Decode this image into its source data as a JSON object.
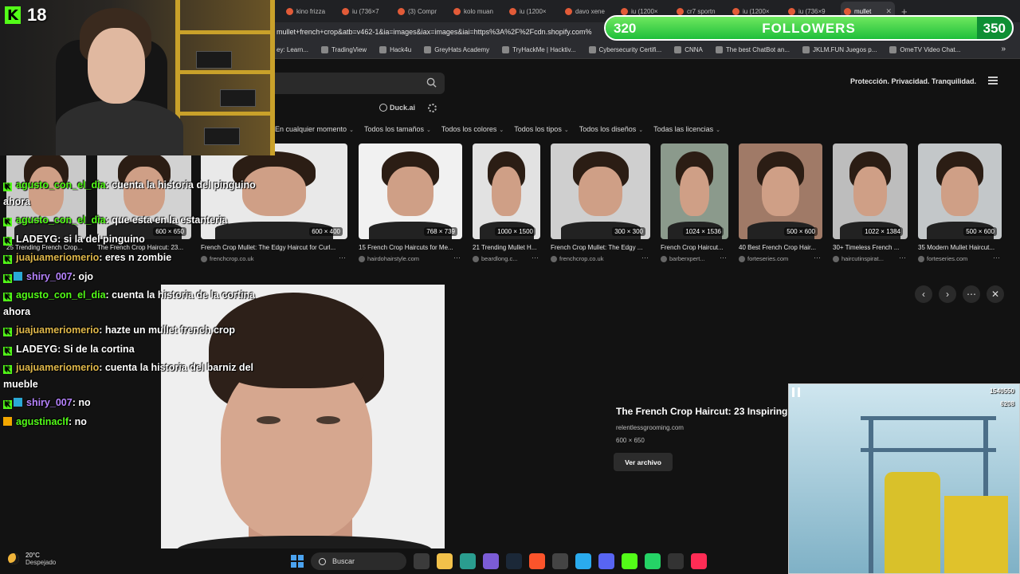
{
  "browser": {
    "tabs": [
      {
        "label": "kino frizza"
      },
      {
        "label": "iu (736×7"
      },
      {
        "label": "(3) Compr"
      },
      {
        "label": "kolo muan"
      },
      {
        "label": "iu (1200×"
      },
      {
        "label": "davo xene"
      },
      {
        "label": "iu (1200×"
      },
      {
        "label": "cr7 sportn"
      },
      {
        "label": "iu (1200×"
      },
      {
        "label": "iu (736×9"
      },
      {
        "label": "mullet"
      }
    ],
    "new_tab": "+",
    "url": "mullet+french+crop&atb=v462-1&ia=images&iax=images&iai=https%3A%2F%2Fcdn.shopify.com%",
    "bookmarks": [
      {
        "label": "ey: Learn..."
      },
      {
        "label": "TradingView"
      },
      {
        "label": "Hack4u"
      },
      {
        "label": "GreyHats Academy"
      },
      {
        "label": "TryHackMe | Hacktiv..."
      },
      {
        "label": "Cybersecurity Certifi..."
      },
      {
        "label": "CNNA"
      },
      {
        "label": "The best ChatBot an..."
      },
      {
        "label": "JKLM.FUN Juegos p..."
      },
      {
        "label": "OmeTV Video Chat..."
      }
    ],
    "bookmarks_more": "»"
  },
  "ddg": {
    "privacy": "Protección. Privacidad. Tranquilidad.",
    "duckai": "Duck.ai",
    "filters": [
      "En cualquier momento",
      "Todos los tamaños",
      "Todos los colores",
      "Todos los tipos",
      "Todos los diseños",
      "Todas las licencias"
    ]
  },
  "results": [
    {
      "size": "",
      "title": "25 Trending French Crop...",
      "source": ""
    },
    {
      "size": "600 × 650",
      "title": "The French Crop Haircut: 23...",
      "source": ""
    },
    {
      "size": "600 × 400",
      "title": "French Crop Mullet: The Edgy Haircut for Curl...",
      "source": "frenchcrop.co.uk"
    },
    {
      "size": "768 × 739",
      "title": "15 French Crop Haircuts for Me...",
      "source": "hairdohairstyle.com"
    },
    {
      "size": "1000 × 1500",
      "title": "21 Trending Mullet H...",
      "source": "beardlong.c..."
    },
    {
      "size": "300 × 300",
      "title": "French Crop Mullet: The Edgy ...",
      "source": "frenchcrop.co.uk"
    },
    {
      "size": "1024 × 1536",
      "title": "French Crop Haircut...",
      "source": "barberxpert..."
    },
    {
      "size": "500 × 600",
      "title": "40 Best French Crop Hair...",
      "source": "forteseries.com"
    },
    {
      "size": "1022 × 1384",
      "title": "30+ Timeless French ...",
      "source": "haircutinspirat..."
    },
    {
      "size": "500 × 600",
      "title": "35 Modern Mullet Haircut...",
      "source": "forteseries.com"
    }
  ],
  "detail": {
    "title": "The French Crop Haircut: 23 Inspiring",
    "source": "relentlessgrooming.com",
    "size": "600 × 650",
    "button": "Ver archivo"
  },
  "stream": {
    "viewer_count": "18",
    "followers": {
      "current": "320",
      "goal": "350",
      "label": "FOLLOWERS",
      "progress": 0.914
    }
  },
  "chat": [
    {
      "user": "agusto_con_el_dia",
      "text": ": cuenta la historia del pinguino ahora",
      "color": "#53fc18",
      "badge": "kick"
    },
    {
      "user": "agusto_con_el_dia",
      "text": ": que esta en la estanteria",
      "color": "#53fc18",
      "badge": "kick"
    },
    {
      "user": "LADEYG",
      "text": ": si la del pinguino",
      "color": "#ffffff",
      "badge": "kick"
    },
    {
      "user": "juajuameriomerio",
      "text": ": eres n zombie",
      "color": "#e0b84a",
      "badge": "kick"
    },
    {
      "user": "shiry_007",
      "text": ": ojo",
      "color": "#b784ff",
      "badge": "kick2"
    },
    {
      "user": "agusto_con_el_dia",
      "text": ": cuenta la historia de la cortina ahora",
      "color": "#53fc18",
      "badge": "kick"
    },
    {
      "user": "juajuameriomerio",
      "text": ": hazte un mullet french crop",
      "color": "#e0b84a",
      "badge": "kick"
    },
    {
      "user": "LADEYG",
      "text": ": Si de la cortina",
      "color": "#ffffff",
      "badge": "kick"
    },
    {
      "user": "juajuameriomerio",
      "text": ": cuenta la historia del barniz del mueble",
      "color": "#e0b84a",
      "badge": "kick"
    },
    {
      "user": "shiry_007",
      "text": ": no",
      "color": "#b784ff",
      "badge": "kick2"
    },
    {
      "user": "agustinaclf",
      "text": ": no",
      "color": "#53fc18",
      "badge": "kick3"
    }
  ],
  "game": {
    "score": "1540550",
    "coins": "6208"
  },
  "taskbar": {
    "temp": "20°C",
    "weather": "Despejado",
    "search": "Buscar"
  }
}
